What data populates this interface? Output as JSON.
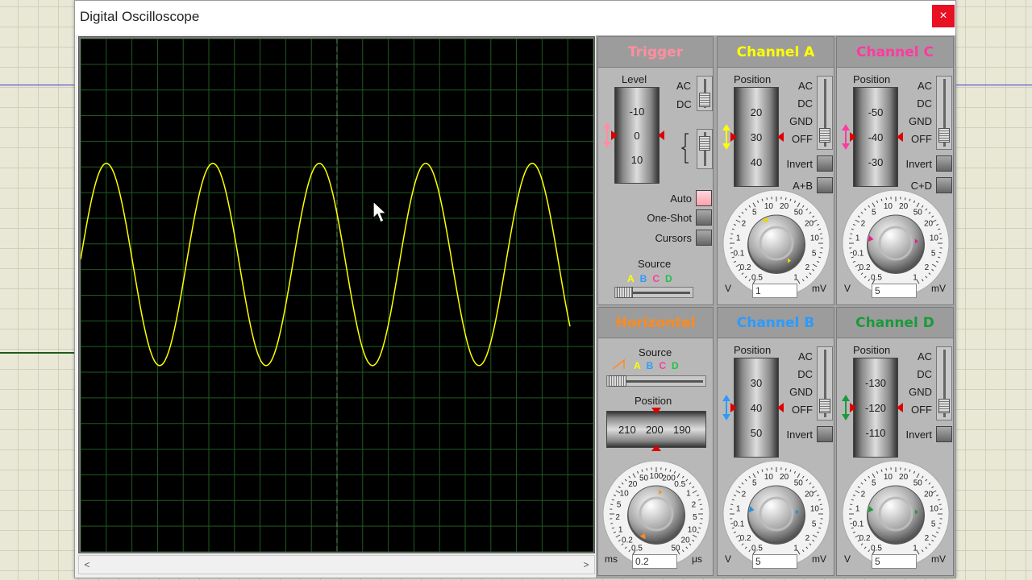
{
  "window": {
    "title": "Digital Oscilloscope",
    "close_glyph": "×"
  },
  "trace": {
    "color": "#ffff00",
    "type": "sine",
    "cycles_visible": 4
  },
  "screen": {
    "background": "#000000",
    "grid_color": "#1f5a1f"
  },
  "scrollbar": {
    "left_arrow": "<",
    "right_arrow": ">"
  },
  "trigger": {
    "title": "Trigger",
    "title_color": "#ff8fa0",
    "level_label": "Level",
    "level_ticks": [
      "-10",
      "0",
      "10"
    ],
    "ac_label": "AC",
    "dc_label": "DC",
    "auto_label": "Auto",
    "oneshot_label": "One-Shot",
    "cursors_label": "Cursors",
    "source_label": "Source",
    "source_letters": [
      "A",
      "B",
      "C",
      "D"
    ]
  },
  "horizontal": {
    "title": "Horizontal",
    "title_color": "#ff8a1e",
    "source_label": "Source",
    "source_letters": [
      "A",
      "B",
      "C",
      "D"
    ],
    "position_label": "Position",
    "position_ticks": [
      "210",
      "200",
      "190"
    ],
    "units": {
      "left": "ms",
      "right": "μs"
    },
    "value": "0.2",
    "scale": [
      "0.5",
      "0.2",
      "1",
      "2",
      "5",
      "10",
      "20",
      "50",
      "100",
      "200",
      "0.5",
      "1",
      "2",
      "5",
      "10",
      "20",
      "50"
    ],
    "knob_color": "#ff8a1e"
  },
  "channels": [
    {
      "id": "A",
      "title": "Channel A",
      "title_color": "#ffff00",
      "position_label": "Position",
      "ticks": [
        "20",
        "30",
        "40"
      ],
      "coupling": [
        "AC",
        "DC",
        "GND",
        "OFF"
      ],
      "invert_label": "Invert",
      "combine_label": "A+B",
      "units": {
        "left": "V",
        "right": "mV"
      },
      "value": "1",
      "knob_color": "#e8d800"
    },
    {
      "id": "C",
      "title": "Channel C",
      "title_color": "#ff3aa0",
      "position_label": "Position",
      "ticks": [
        "-50",
        "-40",
        "-30"
      ],
      "coupling": [
        "AC",
        "DC",
        "GND",
        "OFF"
      ],
      "invert_label": "Invert",
      "combine_label": "C+D",
      "units": {
        "left": "V",
        "right": "mV"
      },
      "value": "5",
      "knob_color": "#e0208c"
    },
    {
      "id": "B",
      "title": "Channel B",
      "title_color": "#2b9bff",
      "position_label": "Position",
      "ticks": [
        "30",
        "40",
        "50"
      ],
      "coupling": [
        "AC",
        "DC",
        "GND",
        "OFF"
      ],
      "invert_label": "Invert",
      "combine_label": "",
      "units": {
        "left": "V",
        "right": "mV"
      },
      "value": "5",
      "knob_color": "#2090e0"
    },
    {
      "id": "D",
      "title": "Channel D",
      "title_color": "#1a9a3a",
      "position_label": "Position",
      "ticks": [
        "-130",
        "-120",
        "-110"
      ],
      "coupling": [
        "AC",
        "DC",
        "GND",
        "OFF"
      ],
      "invert_label": "Invert",
      "combine_label": "",
      "units": {
        "left": "V",
        "right": "mV"
      },
      "value": "5",
      "knob_color": "#1a9a3a"
    }
  ],
  "channel_scale": [
    "0.5",
    "0.2",
    "0.1",
    "1",
    "2",
    "5",
    "10",
    "20",
    "50",
    "20",
    "10",
    "5",
    "2",
    "1"
  ],
  "source_letter_colors": [
    "#ffff00",
    "#2b9bff",
    "#ff3aa0",
    "#22c04a"
  ]
}
